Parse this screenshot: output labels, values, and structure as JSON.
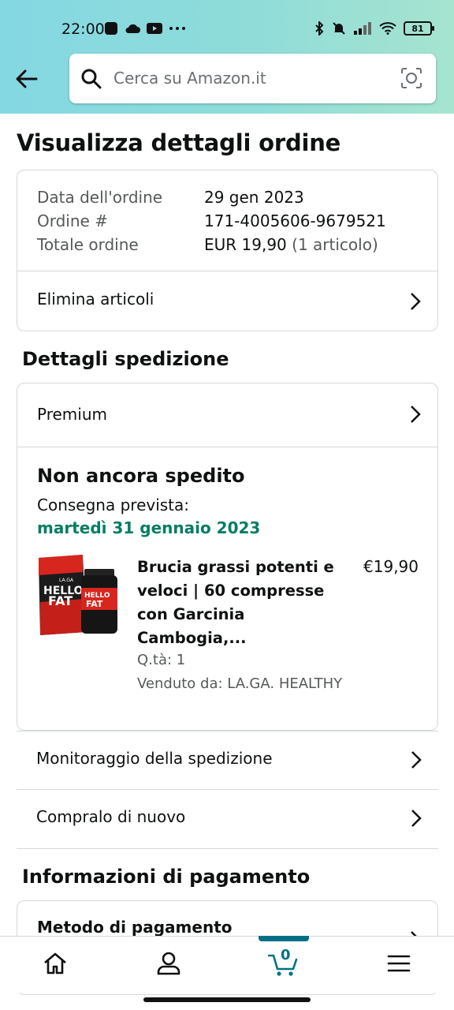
{
  "status_bar": {
    "time": "22:00",
    "battery": "81",
    "icons_left": [
      "square-app-icon",
      "cloud-icon",
      "youtube-icon",
      "more-dots-icon"
    ],
    "icons_right": [
      "bluetooth-icon",
      "mute-bell-icon",
      "signal-icon",
      "wifi-icon",
      "battery-icon"
    ]
  },
  "search": {
    "placeholder": "Cerca su Amazon.it"
  },
  "page": {
    "title": "Visualizza dettagli ordine"
  },
  "order": {
    "date_label": "Data dell'ordine",
    "date_value": "29 gen 2023",
    "number_label": "Ordine #",
    "number_value": "171-4005606-9679521",
    "total_label": "Totale ordine",
    "total_value": "EUR 19,90",
    "total_items": "(1 articolo)",
    "delete_items": "Elimina articoli"
  },
  "shipping": {
    "section_title": "Dettagli spedizione",
    "premium_label": "Premium",
    "status": "Non ancora spedito",
    "delivery_label": "Consegna prevista:",
    "delivery_date": "martedì 31 gennaio 2023",
    "product": {
      "title": "Brucia grassi potenti e veloci | 60 compresse con Garcinia Cambogia,...",
      "price": "€19,90",
      "qty": "Q.tà: 1",
      "seller": "Venduto da: LA.GA. HEALTHY",
      "image_text_top": "HELLO",
      "image_text_bottom": "FAT",
      "brand": "LA.GA"
    }
  },
  "actions": {
    "track": "Monitoraggio della spedizione",
    "buy_again": "Compralo di nuovo"
  },
  "payment": {
    "section_title": "Informazioni di pagamento",
    "method_label": "Metodo di pagamento"
  },
  "bottom_nav": {
    "cart_count": "0",
    "items": [
      "home-icon",
      "account-icon",
      "cart-icon",
      "menu-icon"
    ]
  },
  "colors": {
    "header_gradient_start": "#84d8e3",
    "header_gradient_end": "#a6e4cf",
    "delivery_green": "#067d62",
    "accent_teal": "#007185"
  }
}
